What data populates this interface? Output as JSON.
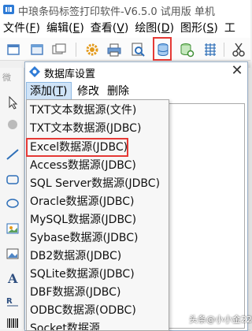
{
  "app": {
    "title": "中琅条码标签打印软件-V6.5.0 试用版 单机"
  },
  "menubar": [
    {
      "label": "文件(",
      "key": "F",
      "suffix": ")"
    },
    {
      "label": "编辑(",
      "key": "E",
      "suffix": ")"
    },
    {
      "label": "查看(",
      "key": "V",
      "suffix": ")"
    },
    {
      "label": "绘图(",
      "key": "D",
      "suffix": ")"
    },
    {
      "label": "图形(",
      "key": "S",
      "suffix": ")"
    },
    {
      "label": "工"
    }
  ],
  "palette": {
    "label": "微"
  },
  "dialog": {
    "title": "数据库设置",
    "close": "✕",
    "menu": [
      {
        "label": "添加(",
        "key": "T",
        "suffix": ")"
      },
      {
        "label": "修改"
      },
      {
        "label": "删除"
      }
    ]
  },
  "dropdown": {
    "items": [
      "TXT文本数据源(文件)",
      "TXT文本数据源(JDBC)",
      "Excel数据源(JDBC)",
      "Access数据源(JDBC)",
      "SQL Server数据源(JDBC)",
      "Oracle数据源(JDBC)",
      "MySQL数据源(JDBC)",
      "Sybase数据源(JDBC)",
      "DB2数据源(JDBC)",
      "SQLite数据源(JDBC)",
      "DBF数据源(JDBC)",
      "ODBC数据源(ODBC)",
      "Socket数据源"
    ],
    "highlighted": "Excel数据源(JDBC)"
  },
  "watermark": "头条@小小金225",
  "colors": {
    "highlight": "#e53935",
    "menu_active": "#cfe3f7"
  },
  "icons": [
    "app-logo-icon",
    "new-icon",
    "window-icon",
    "settings-icon",
    "print-icon",
    "print-preview-icon",
    "database-icon",
    "database-settings-icon",
    "grid-icon",
    "cut-icon"
  ]
}
